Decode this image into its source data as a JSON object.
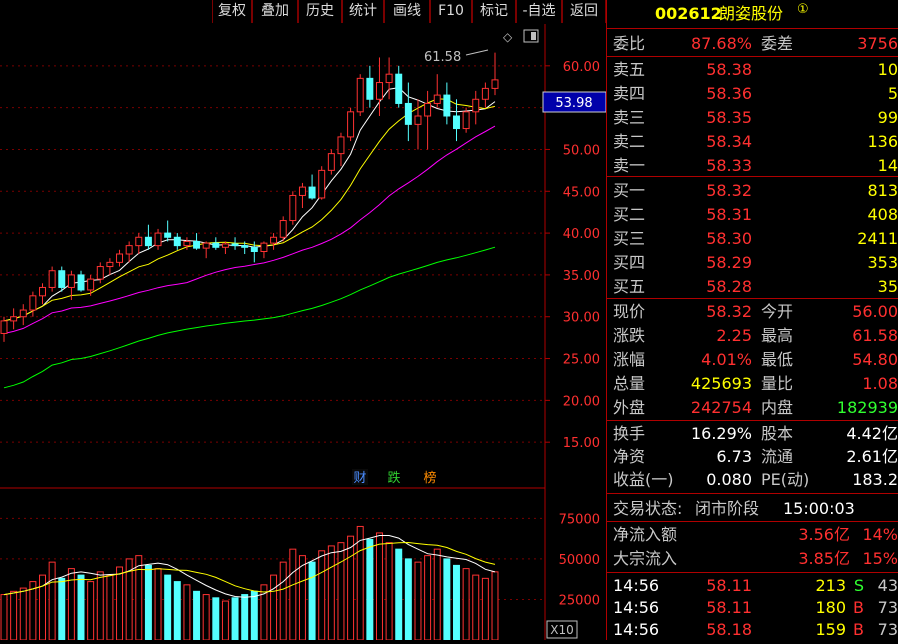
{
  "toolbar": {
    "buttons": [
      "复权",
      "叠加",
      "历史",
      "统计",
      "画线",
      "F10",
      "标记",
      "-自选",
      "返回"
    ]
  },
  "stock": {
    "code": "002612",
    "name": "朗姿股份",
    "badge": "①"
  },
  "chart": {
    "price_axis": [
      "60.00",
      "55.00",
      "50.00",
      "45.00",
      "40.00",
      "35.00",
      "30.00",
      "25.00",
      "20.00",
      "15.00"
    ],
    "current_price_tag": "53.98",
    "high_annotation": "61.58",
    "vol_axis": [
      "75000",
      "50000",
      "25000"
    ],
    "vol_unit": "X10",
    "tags": [
      {
        "text": "财",
        "color": "#4a8cff"
      },
      {
        "text": "跌",
        "color": "#30d030"
      },
      {
        "text": "榜",
        "color": "#ff8c00"
      }
    ]
  },
  "chart_data": {
    "type": "candlestick",
    "ylim": [
      10,
      65
    ],
    "vol_ylim": [
      0,
      90000
    ],
    "candles": [
      [
        28,
        30,
        27,
        29.5,
        28000
      ],
      [
        29.5,
        31,
        28.5,
        30,
        30000
      ],
      [
        30,
        31.5,
        29,
        30.8,
        32000
      ],
      [
        30.8,
        33,
        30,
        32.5,
        36000
      ],
      [
        32.5,
        34,
        31.5,
        33.5,
        40000
      ],
      [
        33.5,
        36,
        33,
        35.5,
        48000
      ],
      [
        35.5,
        36,
        33,
        33.5,
        38000
      ],
      [
        33.5,
        35.5,
        32,
        35,
        44000
      ],
      [
        35,
        35.5,
        33,
        33.2,
        40000
      ],
      [
        33.2,
        35,
        32.5,
        34.5,
        36000
      ],
      [
        34.5,
        36.5,
        34,
        36,
        42000
      ],
      [
        36,
        37,
        35,
        36.5,
        40000
      ],
      [
        36.5,
        38,
        36,
        37.5,
        45000
      ],
      [
        37.5,
        39,
        36.5,
        38.5,
        50000
      ],
      [
        38.5,
        40,
        37.5,
        39.5,
        52000
      ],
      [
        39.5,
        41,
        38,
        38.5,
        46000
      ],
      [
        38.5,
        40.5,
        38,
        40,
        44000
      ],
      [
        40,
        41.5,
        39,
        39.5,
        40000
      ],
      [
        39.5,
        40,
        38,
        38.5,
        36000
      ],
      [
        38.5,
        39.5,
        38,
        39,
        34000
      ],
      [
        39,
        40,
        38,
        38.2,
        30000
      ],
      [
        38.2,
        39,
        37,
        38.8,
        28000
      ],
      [
        38.8,
        39.5,
        38,
        38.3,
        26000
      ],
      [
        38.3,
        39,
        37.5,
        38.7,
        24000
      ],
      [
        38.7,
        39.5,
        38,
        38.5,
        26000
      ],
      [
        38.5,
        39,
        37.5,
        38.3,
        28000
      ],
      [
        38.3,
        39,
        36.5,
        37.8,
        30000
      ],
      [
        37.8,
        39,
        37,
        38.8,
        34000
      ],
      [
        38.8,
        40,
        38,
        39.5,
        40000
      ],
      [
        39.5,
        42,
        39,
        41.5,
        48000
      ],
      [
        41.5,
        45,
        41,
        44.5,
        56000
      ],
      [
        44.5,
        46,
        43,
        45.5,
        52000
      ],
      [
        45.5,
        47,
        44,
        44.2,
        48000
      ],
      [
        44.2,
        48,
        44,
        47.5,
        55000
      ],
      [
        47.5,
        50,
        47,
        49.5,
        58000
      ],
      [
        49.5,
        52,
        48,
        51.5,
        60000
      ],
      [
        51.5,
        55,
        51,
        54.5,
        64000
      ],
      [
        54.5,
        59,
        54,
        58.5,
        70000
      ],
      [
        58.5,
        60,
        55,
        56,
        62000
      ],
      [
        56,
        61,
        54,
        58,
        66000
      ],
      [
        58,
        61,
        56,
        59,
        60000
      ],
      [
        59,
        60,
        55,
        55.5,
        56000
      ],
      [
        55.5,
        58,
        51,
        53,
        50000
      ],
      [
        53,
        56,
        50,
        54,
        48000
      ],
      [
        54,
        57,
        50,
        55.5,
        52000
      ],
      [
        55.5,
        59,
        55,
        56.5,
        56000
      ],
      [
        56.5,
        58,
        53,
        54,
        50000
      ],
      [
        54,
        56,
        51,
        52.5,
        46000
      ],
      [
        52.5,
        55,
        52,
        54.5,
        44000
      ],
      [
        54.5,
        57,
        53,
        56,
        40000
      ],
      [
        56,
        58,
        55,
        57.3,
        38000
      ],
      [
        57.3,
        61.58,
        56.5,
        58.32,
        42000
      ]
    ],
    "ma_colors": [
      "#ffffff",
      "#ffff00",
      "#ff00ff",
      "#00ff00"
    ]
  },
  "quote": {
    "weibi": {
      "label": "委比",
      "value": "87.68%",
      "label2": "委差",
      "value2": "3756"
    },
    "sells": [
      {
        "label": "卖五",
        "price": "58.38",
        "vol": "10"
      },
      {
        "label": "卖四",
        "price": "58.36",
        "vol": "5"
      },
      {
        "label": "卖三",
        "price": "58.35",
        "vol": "99"
      },
      {
        "label": "卖二",
        "price": "58.34",
        "vol": "136"
      },
      {
        "label": "卖一",
        "price": "58.33",
        "vol": "14"
      }
    ],
    "buys": [
      {
        "label": "买一",
        "price": "58.32",
        "vol": "813"
      },
      {
        "label": "买二",
        "price": "58.31",
        "vol": "408"
      },
      {
        "label": "买三",
        "price": "58.30",
        "vol": "2411"
      },
      {
        "label": "买四",
        "price": "58.29",
        "vol": "353"
      },
      {
        "label": "买五",
        "price": "58.28",
        "vol": "35"
      }
    ],
    "stats": [
      {
        "l1": "现价",
        "v1": "58.32",
        "c1": "#ff3030",
        "l2": "今开",
        "v2": "56.00",
        "c2": "#ff3030"
      },
      {
        "l1": "涨跌",
        "v1": "2.25",
        "c1": "#ff3030",
        "l2": "最高",
        "v2": "61.58",
        "c2": "#ff3030"
      },
      {
        "l1": "涨幅",
        "v1": "4.01%",
        "c1": "#ff3030",
        "l2": "最低",
        "v2": "54.80",
        "c2": "#ff3030"
      },
      {
        "l1": "总量",
        "v1": "425693",
        "c1": "#ffff00",
        "l2": "量比",
        "v2": "1.08",
        "c2": "#ff3030"
      },
      {
        "l1": "外盘",
        "v1": "242754",
        "c1": "#ff3030",
        "l2": "内盘",
        "v2": "182939",
        "c2": "#30ff30"
      }
    ],
    "stats2": [
      {
        "l1": "换手",
        "v1": "16.29%",
        "l2": "股本",
        "v2": "4.42亿"
      },
      {
        "l1": "净资",
        "v1": "6.73",
        "l2": "流通",
        "v2": "2.61亿"
      },
      {
        "l1": "收益(一)",
        "v1": "0.080",
        "l2": "PE(动)",
        "v2": "183.2"
      }
    ],
    "status": {
      "label": "交易状态:",
      "state": "闭市阶段",
      "time": "15:00:03"
    },
    "flows": [
      {
        "label": "净流入额",
        "value": "3.56亿",
        "pct": "14%"
      },
      {
        "label": "大宗流入",
        "value": "3.85亿",
        "pct": "15%"
      }
    ],
    "ticks": [
      {
        "time": "14:56",
        "price": "58.11",
        "vol": "213",
        "side": "S",
        "side_color": "#30ff30",
        "count": "43"
      },
      {
        "time": "14:56",
        "price": "58.11",
        "vol": "180",
        "side": "B",
        "side_color": "#ff3030",
        "count": "73"
      },
      {
        "time": "14:56",
        "price": "58.18",
        "vol": "159",
        "side": "B",
        "side_color": "#ff3030",
        "count": "73"
      }
    ]
  }
}
